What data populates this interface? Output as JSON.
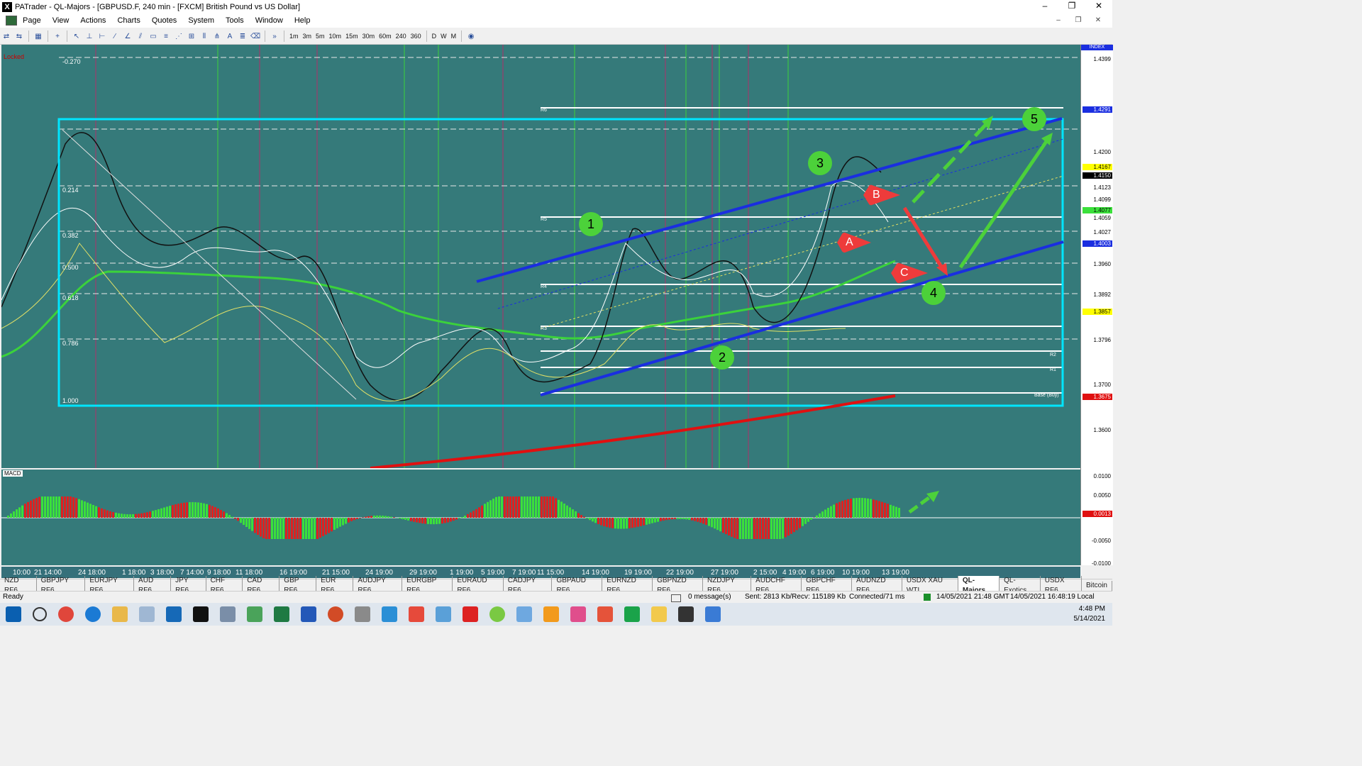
{
  "window": {
    "title": "PATrader - QL-Majors - [GBPUSD.F, 240 min - [FXCM] British Pound vs US Dollar]",
    "app_icon": "X",
    "minimize": "–",
    "maximize": "❐",
    "close": "✕"
  },
  "menu": [
    "Page",
    "View",
    "Actions",
    "Charts",
    "Quotes",
    "System",
    "Tools",
    "Window",
    "Help"
  ],
  "toolbar": {
    "timeframes": [
      "1m",
      "3m",
      "5m",
      "10m",
      "15m",
      "30m",
      "60m",
      "240",
      "360",
      "D",
      "W",
      "M"
    ]
  },
  "chart": {
    "locked_label": "Locked",
    "fib_levels": [
      "-0.270",
      "0.214",
      "0.382",
      "0.500",
      "0.618",
      "0.786",
      "1.000"
    ],
    "pivot_labels": [
      "R6",
      "R5",
      "R4",
      "R3",
      "R2",
      "R1",
      "Base (Buy)"
    ],
    "wave_labels": [
      "1",
      "2",
      "3",
      "4",
      "5"
    ],
    "corrective_labels": [
      "A",
      "B",
      "C"
    ],
    "indicator_label": "MACD",
    "index_label": "INDEX"
  },
  "price_axis": [
    {
      "text": "1.4399",
      "style": "plain"
    },
    {
      "text": "1.4291",
      "style": "blue"
    },
    {
      "text": "1.4200",
      "style": "plain"
    },
    {
      "text": "1.4167",
      "style": "yellow"
    },
    {
      "text": "1.4150",
      "style": "black"
    },
    {
      "text": "1.4123",
      "style": "plain"
    },
    {
      "text": "1.4099",
      "style": "plain"
    },
    {
      "text": "1.4077",
      "style": "green"
    },
    {
      "text": "1.4059",
      "style": "plain"
    },
    {
      "text": "1.4027",
      "style": "plain"
    },
    {
      "text": "1.4003",
      "style": "blue"
    },
    {
      "text": "1.3960",
      "style": "plain"
    },
    {
      "text": "1.3892",
      "style": "plain"
    },
    {
      "text": "1.3857",
      "style": "yellow"
    },
    {
      "text": "1.3796",
      "style": "plain"
    },
    {
      "text": "1.3700",
      "style": "plain"
    },
    {
      "text": "1.3675",
      "style": "red"
    },
    {
      "text": "1.3600",
      "style": "plain"
    }
  ],
  "macd_axis": [
    "0.0100",
    "0.0050",
    "0.0013",
    "-0.0050",
    "-0.0100"
  ],
  "time_axis": [
    "10:00",
    "21 14:00",
    "24 18:00",
    "1 18:00",
    "3 18:00",
    "7 14:00",
    "9 18:00",
    "11 18:00",
    "16 19:00",
    "21 15:00",
    "24 19:00",
    "29 19:00",
    "1 19:00",
    "5 19:00",
    "7 19:00",
    "11 15:00",
    "14 19:00",
    "19 19:00",
    "22 19:00",
    "27 19:00",
    "2 15:00",
    "4 19:00",
    "6 19:00",
    "10 19:00",
    "13 19:00"
  ],
  "tabs": [
    "NZD RF6",
    "GBPJPY RF6",
    "EURJPY RF6",
    "AUD RF6",
    "JPY RF6",
    "CHF RF6",
    "CAD RF6",
    "GBP RF6",
    "EUR RF6",
    "AUDJPY RF6",
    "EURGBP RF6",
    "EURAUD RF6",
    "CADJPY RF6",
    "GBPAUD RF6",
    "EURNZD RF6",
    "GBPNZD RF6",
    "NZDJPY RF6",
    "AUDCHF RF6",
    "GBPCHF RF6",
    "AUDNZD RF6",
    "USDX XAU WTI",
    "QL-Majors",
    "QL-Exotics",
    "USDX RF6",
    "Bitcoin"
  ],
  "active_tab": "QL-Majors",
  "status": {
    "ready": "Ready",
    "messages": "0 message(s)",
    "traffic": "Sent: 2813 Kb/Recv: 115189 Kb",
    "connection": "Connected/71 ms",
    "gmt_time": "14/05/2021 21:48 GMT",
    "local_time": "14/05/2021 16:48:19 Local"
  },
  "taskbar": {
    "time": "4:48 PM",
    "date": "5/14/2021"
  },
  "colors": {
    "chart_bg": "#357a7a",
    "channel": "#1a2ee0",
    "fib_box": "#00e5ff",
    "ema_green": "#3bd23b",
    "trend_red": "#e01010",
    "label_green": "#4cd13a",
    "label_red": "#ee3b3b"
  }
}
